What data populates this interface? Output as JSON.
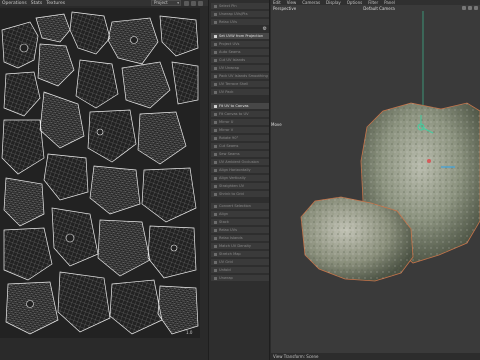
{
  "uv_editor": {
    "menu": [
      "Operations",
      "Stats",
      "Textures"
    ],
    "projection_dropdown": "Project",
    "corner_value": "1.0"
  },
  "tools": {
    "items": [
      {
        "label": "Select Pin",
        "active": false
      },
      {
        "label": "Unwrap UVs/Pts",
        "active": false
      },
      {
        "label": "Relax UVs",
        "active": false
      },
      {
        "label": "Set UVW from Projection",
        "active": true
      },
      {
        "label": "Project UVs",
        "active": false
      },
      {
        "label": "Auto Seams",
        "active": false
      },
      {
        "label": "Cut UV Islands",
        "active": false
      },
      {
        "label": "UV Unwrap",
        "active": false
      },
      {
        "label": "Pack UV Islands Smoothing",
        "active": false
      },
      {
        "label": "UV Terrace Shell",
        "active": false
      },
      {
        "label": "UV Pack",
        "active": false
      },
      {
        "label": "Fit UV to Canvas",
        "active": true
      },
      {
        "label": "Fit Canvas to UV",
        "active": false
      },
      {
        "label": "Mirror U",
        "active": false
      },
      {
        "label": "Mirror V",
        "active": false
      },
      {
        "label": "Rotate 90°",
        "active": false
      },
      {
        "label": "Cut Seams",
        "active": false
      },
      {
        "label": "Sew Seams",
        "active": false
      },
      {
        "label": "UV Ambient Occlusion",
        "active": false
      },
      {
        "label": "Align Horizontally",
        "active": false
      },
      {
        "label": "Align Vertically",
        "active": false
      },
      {
        "label": "Straighten UV",
        "active": false
      },
      {
        "label": "Shrink to Grid",
        "active": false
      },
      {
        "label": "Convert Selection",
        "active": false
      },
      {
        "label": "Align",
        "active": false
      },
      {
        "label": "Stack",
        "active": false
      },
      {
        "label": "Relax UVs",
        "active": false
      },
      {
        "label": "Relax Islands",
        "active": false
      },
      {
        "label": "Match UV Density",
        "active": false
      },
      {
        "label": "Stretch Map",
        "active": false
      },
      {
        "label": "UV Grid",
        "active": false
      },
      {
        "label": "Unfold",
        "active": false
      },
      {
        "label": "Unwrap",
        "active": false
      }
    ]
  },
  "viewport": {
    "menu": [
      "Edit",
      "View",
      "Cameras",
      "Display",
      "Options",
      "Filter",
      "Panel"
    ],
    "projection": "Perspective",
    "camera": "Default Camera",
    "transform_label": "Move",
    "status": "View Transform: Scene",
    "colors": {
      "background": "#3a3a3a",
      "y_axis": "#3fd0a0",
      "rock_outline": "#c7744a"
    }
  }
}
